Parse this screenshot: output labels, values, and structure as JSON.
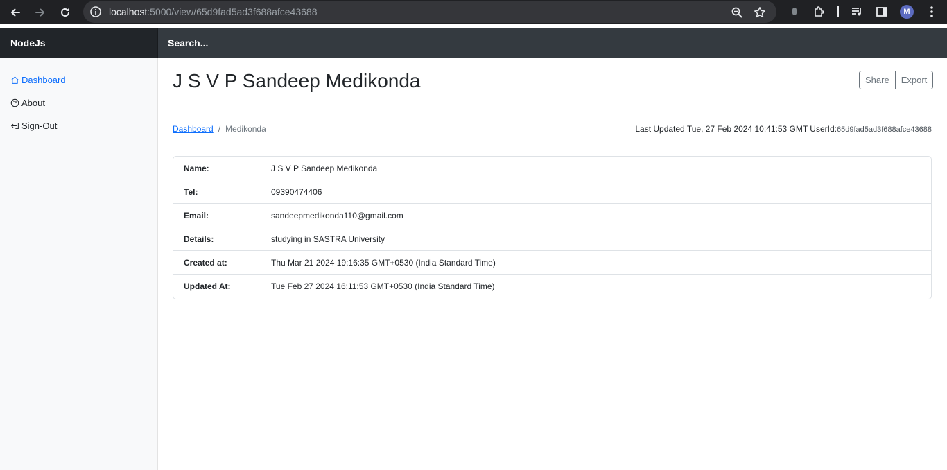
{
  "browser": {
    "url_host": "localhost",
    "url_rest": ":5000/view/65d9fad5ad3f688afce43688",
    "profile_initial": "M"
  },
  "navbar": {
    "brand": "NodeJs",
    "search_placeholder": "Search..."
  },
  "sidebar": {
    "items": [
      {
        "label": "Dashboard",
        "icon": "house-icon"
      },
      {
        "label": "About",
        "icon": "question-circle-icon"
      },
      {
        "label": "Sign-Out",
        "icon": "sign-out-icon"
      }
    ]
  },
  "main": {
    "title": "J S V P Sandeep Medikonda",
    "actions": {
      "share": "Share",
      "export": "Export"
    },
    "breadcrumb": {
      "root": "Dashboard",
      "separator": "/",
      "current": "Medikonda"
    },
    "last_updated": "Last Updated Tue, 27 Feb 2024 10:41:53 GMT UserId:",
    "user_id": "65d9fad5ad3f688afce43688",
    "details": [
      {
        "label": "Name:",
        "value": "J S V P Sandeep Medikonda"
      },
      {
        "label": "Tel:",
        "value": "09390474406"
      },
      {
        "label": "Email:",
        "value": "sandeepmedikonda110@gmail.com"
      },
      {
        "label": "Details:",
        "value": "studying in SASTRA University"
      },
      {
        "label": "Created at:",
        "value": "Thu Mar 21 2024 19:16:35 GMT+0530 (India Standard Time)"
      },
      {
        "label": "Updated At:",
        "value": "Tue Feb 27 2024 16:11:53 GMT+0530 (India Standard Time)"
      }
    ]
  },
  "colors": {
    "accent": "#0d6efd",
    "navbar_bg": "#343a40",
    "brand_bg": "#212529",
    "chrome_bg": "#202124"
  }
}
